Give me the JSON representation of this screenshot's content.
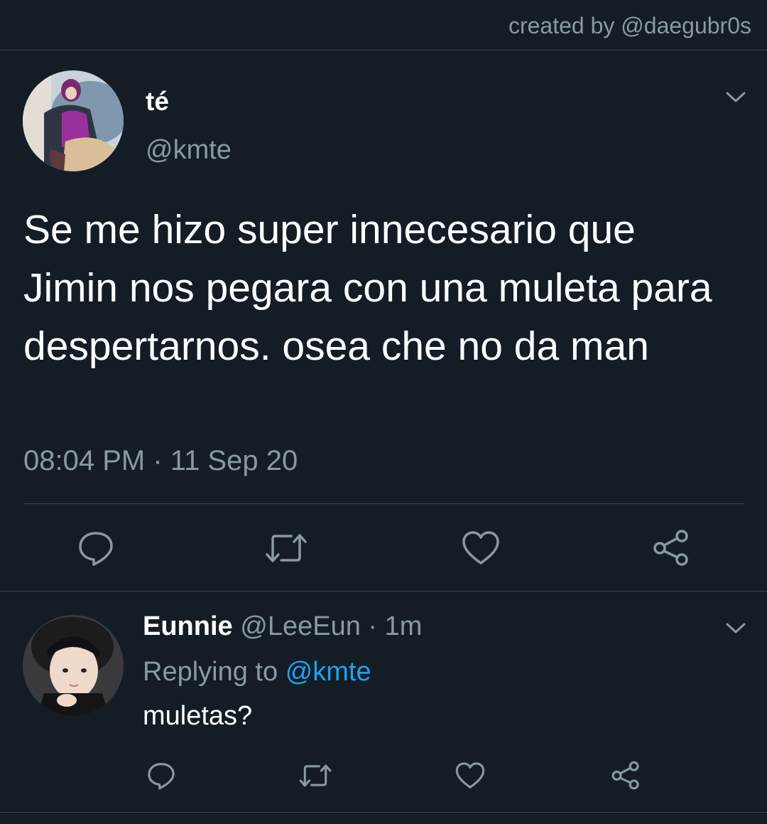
{
  "credit": "created by @daegubr0s",
  "tweet": {
    "name": "té",
    "handle": "@kmte",
    "text": "Se me hizo super innecesario que Jimin nos pegara con una muleta para despertarnos. osea che no da man",
    "time": "08:04 PM",
    "separator": "·",
    "date": "11 Sep 20",
    "menu_icon": "chevron-down-icon",
    "actions": [
      "reply-icon",
      "retweet-icon",
      "like-icon",
      "share-icon"
    ]
  },
  "reply": {
    "name": "Eunnie",
    "handle": "@LeeEun",
    "separator": "·",
    "age": "1m",
    "replying_prefix": "Replying to",
    "replying_to": "@kmte",
    "text": "muletas?",
    "menu_icon": "chevron-down-icon",
    "actions": [
      "reply-icon",
      "retweet-icon",
      "like-icon",
      "share-icon"
    ]
  },
  "colors": {
    "background": "#141d26",
    "muted": "#8899a6",
    "accent": "#1da1f2",
    "divider": "#38444d"
  }
}
